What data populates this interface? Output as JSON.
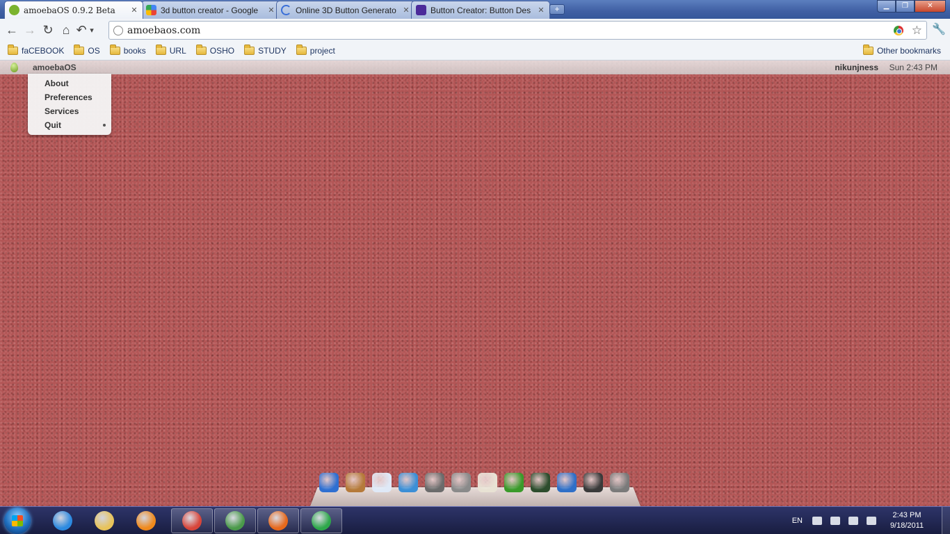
{
  "browser": {
    "tabs": [
      {
        "title": "amoebaOS 0.9.2 Beta",
        "active": true,
        "favicon_color": "#7bb32e"
      },
      {
        "title": "3d button creator - Google",
        "active": false,
        "favicon_color": "#4285f4"
      },
      {
        "title": "Online 3D Button Generato",
        "active": false,
        "favicon_color": "#3a6fd8"
      },
      {
        "title": "Button Creator: Button Des",
        "active": false,
        "favicon_color": "#4b2a9a"
      }
    ],
    "tab_close": "✕",
    "new_tab": "+",
    "window_controls": {
      "minimize": "▁",
      "maximize": "❐",
      "close": "✕"
    },
    "nav": {
      "back": "←",
      "forward": "→",
      "reload": "↻",
      "home": "⌂",
      "history": "↶",
      "history_menu": "▾"
    },
    "url": "amoebaos.com",
    "star": "☆",
    "wrench": "🔧",
    "bookmarks": [
      "faCEBOOK",
      "OS",
      "books",
      "URL",
      "OSHO",
      "STUDY",
      "project"
    ],
    "other_bookmarks": "Other bookmarks"
  },
  "amoeba": {
    "app_menu": "amoebaOS",
    "user": "nikunjness",
    "clock": "Sun 2:43 PM",
    "dropdown": [
      "About",
      "Preferences",
      "Services",
      "Quit"
    ],
    "dock_items": [
      {
        "name": "globe-network-icon",
        "color": "#2f6fd1"
      },
      {
        "name": "coffee-cup-icon",
        "color": "#b57a3a"
      },
      {
        "name": "window-app-icon",
        "color": "#dfe9f7"
      },
      {
        "name": "earth-icon",
        "color": "#3c8fd6"
      },
      {
        "name": "headphones-icon",
        "color": "#6b6b6b"
      },
      {
        "name": "pen-icon",
        "color": "#8a8a8a"
      },
      {
        "name": "mail-icon",
        "color": "#e8e2d4"
      },
      {
        "name": "bird-icon",
        "color": "#3a9a2a"
      },
      {
        "name": "stock-chart-icon",
        "color": "#2d4d2d"
      },
      {
        "name": "notebook-pen-icon",
        "color": "#2f6fc7"
      },
      {
        "name": "paint-bucket-icon",
        "color": "#3a3a3a"
      },
      {
        "name": "trash-icon",
        "color": "#7a7a7a"
      }
    ]
  },
  "taskbar": {
    "pinned": [
      {
        "name": "internet-explorer-icon",
        "color": "#2d8ae0",
        "running": false
      },
      {
        "name": "windows-explorer-icon",
        "color": "#e8c35a",
        "running": false
      },
      {
        "name": "media-player-icon",
        "color": "#f08a1c",
        "running": false
      },
      {
        "name": "chrome-icon",
        "color": "#d8453a",
        "running": true
      },
      {
        "name": "remote-desktop-icon",
        "color": "#4a9a4a",
        "running": true
      },
      {
        "name": "firefox-icon",
        "color": "#e6691c",
        "running": true
      },
      {
        "name": "download-manager-icon",
        "color": "#2da84a",
        "running": true
      }
    ],
    "language": "EN",
    "time": "2:43 PM",
    "date": "9/18/2011"
  }
}
